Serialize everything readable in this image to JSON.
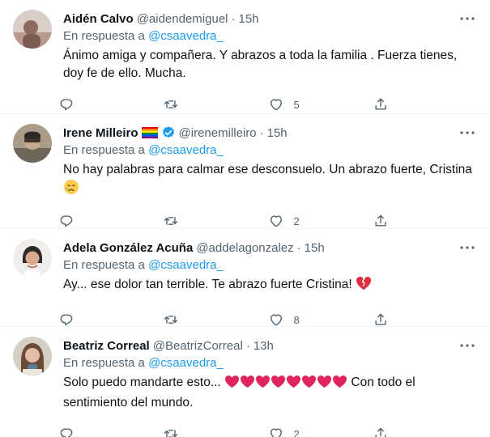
{
  "reply_prefix": "En respuesta a",
  "tweets": [
    {
      "name": "Aidén Calvo",
      "handle": "@aidendemiguel",
      "time": "15h",
      "reply_to": "@csaavedra_",
      "text": "Ánimo amiga y compañera. Y abrazos a toda la familia . Fuerza tienes, doy fe de ello. Mucha.",
      "likes": "5",
      "avatar_color": "#c9b6ae"
    },
    {
      "name": "Irene Milleiro",
      "handle": "@irenemilleiro",
      "time": "15h",
      "reply_to": "@csaavedra_",
      "text": "No hay palabras para calmar ese desconsuelo. Un abrazo fuerte, Cristina",
      "likes": "2",
      "avatar_color": "#9b8e7a",
      "badges": [
        "rainbow-flag",
        "verified"
      ],
      "emoji": "crying-face"
    },
    {
      "name": "Adela González Acuña",
      "handle": "@addelagonzalez",
      "time": "15h",
      "reply_to": "@csaavedra_",
      "text": "Ay... ese dolor tan terrible. Te abrazo fuerte Cristina!",
      "likes": "8",
      "avatar_color": "#e8e6e4",
      "emoji": "broken-heart"
    },
    {
      "name": "Beatriz Correal",
      "handle": "@BeatrizCorreal",
      "time": "13h",
      "reply_to": "@csaavedra_",
      "text_before": "Solo puedo mandarte esto...",
      "text_after": "Con todo el sentimiento del mundo.",
      "likes": "2",
      "avatar_color": "#c7b5a3",
      "emoji": "red-heart",
      "heart_count": 8
    }
  ],
  "colors": {
    "accent": "#1d9bf0",
    "muted": "#536471",
    "divider": "#eff3f4",
    "heart_red": "#e0245e"
  }
}
